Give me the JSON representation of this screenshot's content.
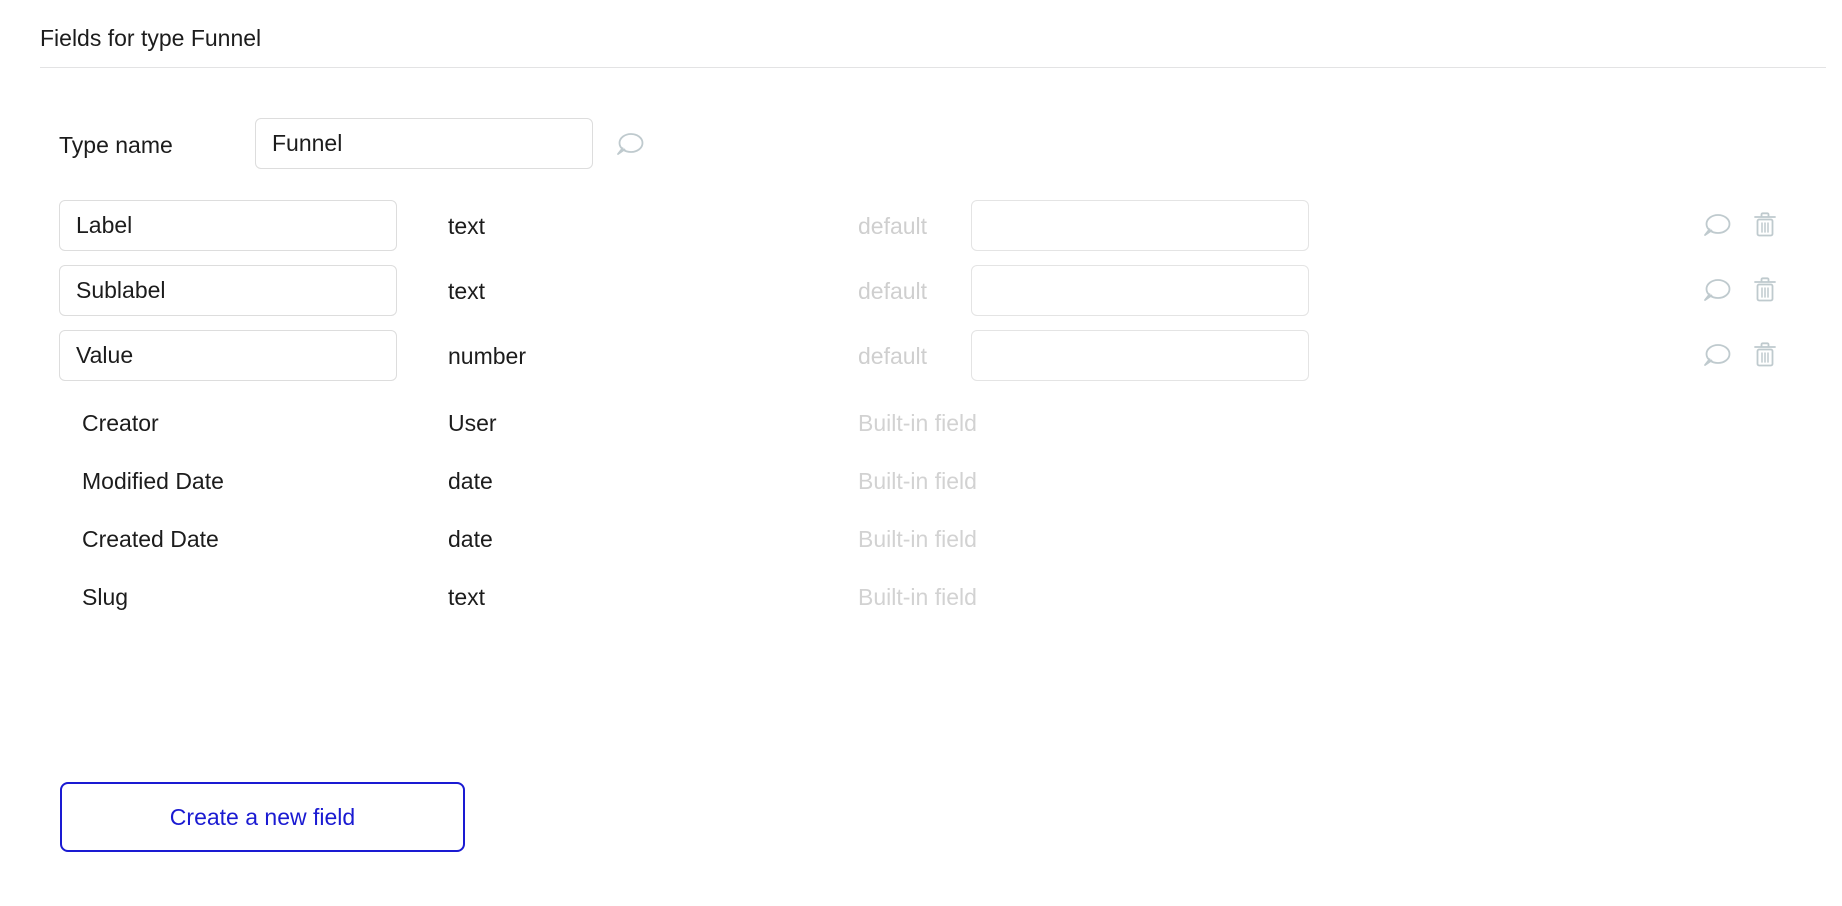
{
  "header": {
    "title": "Fields for type Funnel"
  },
  "type_name": {
    "label": "Type name",
    "value": "Funnel",
    "placeholder": "",
    "comment_icon": "comment-icon"
  },
  "columns": {
    "default_label": "default",
    "builtin_note": "Built-in field"
  },
  "fields": [
    {
      "name": "Label",
      "type": "text",
      "default_label": "default",
      "default_value": "",
      "default_placeholder": "",
      "comment_icon": "comment-icon",
      "delete_icon": "trash-icon"
    },
    {
      "name": "Sublabel",
      "type": "text",
      "default_label": "default",
      "default_value": "",
      "default_placeholder": "",
      "comment_icon": "comment-icon",
      "delete_icon": "trash-icon"
    },
    {
      "name": "Value",
      "type": "number",
      "default_label": "default",
      "default_value": "",
      "default_placeholder": "",
      "comment_icon": "comment-icon",
      "delete_icon": "trash-icon"
    }
  ],
  "builtin_fields": [
    {
      "name": "Creator",
      "type": "User",
      "note": "Built-in field"
    },
    {
      "name": "Modified Date",
      "type": "date",
      "note": "Built-in field"
    },
    {
      "name": "Created Date",
      "type": "date",
      "note": "Built-in field"
    },
    {
      "name": "Slug",
      "type": "text",
      "note": "Built-in field"
    }
  ],
  "actions": {
    "create_field_label": "Create a new field"
  },
  "colors": {
    "accent_blue": "#1a1ad2",
    "icon_gray": "#bfcace",
    "muted_text": "#d0d0d0",
    "border": "#dddddd",
    "divider": "#e3e3e4",
    "text": "#1c1c1c",
    "background": "#ffffff"
  }
}
